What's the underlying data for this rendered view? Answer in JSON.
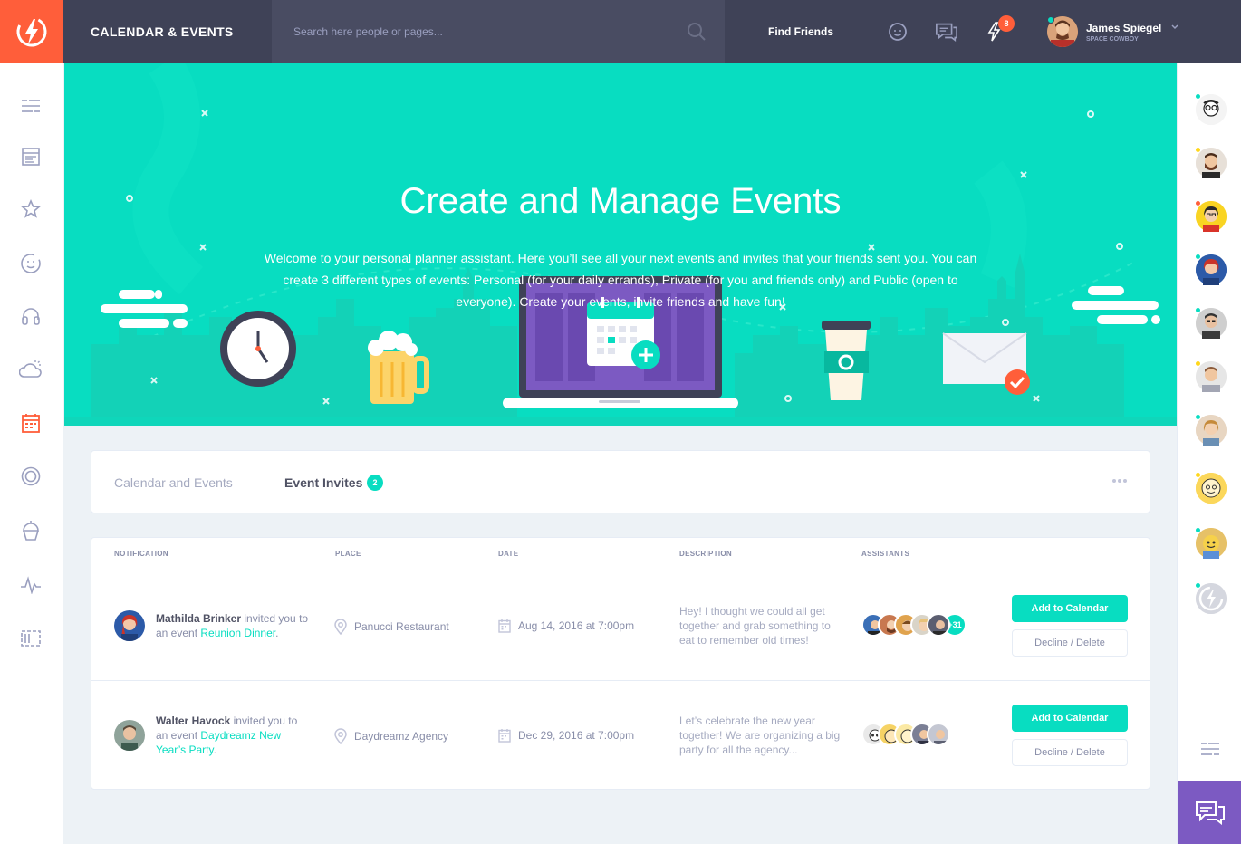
{
  "header": {
    "title": "CALENDAR & EVENTS",
    "search_placeholder": "Search here people or pages...",
    "find_friends": "Find Friends",
    "notification_count": "8",
    "user": {
      "name": "James Spiegel",
      "role": "SPACE COWBOY"
    }
  },
  "hero": {
    "title": "Create and Manage Events",
    "text": "Welcome to your personal planner assistant. Here you’ll see all your next events and invites that your friends sent you. You can create 3 different types of events: Personal (for your daily errands), Private (for you and friends only) and Public (open to everyone). Create your events, invite friends and have fun!"
  },
  "tabs": {
    "items": [
      {
        "label": "Calendar and Events"
      },
      {
        "label": "Event Invites",
        "badge": "2"
      }
    ]
  },
  "table": {
    "columns": [
      "NOTIFICATION",
      "PLACE",
      "DATE",
      "DESCRIPTION",
      "ASSISTANTS"
    ],
    "rows": [
      {
        "name": "Mathilda Brinker",
        "invited_text": " invited you to an event ",
        "event": "Reunion Dinner",
        "end": ".",
        "place": "Panucci Restaurant",
        "date": "Aug 14, 2016 at 7:00pm",
        "description": "Hey! I thought we could all get together and grab something to eat to remember old times!",
        "assistants_more": "+31",
        "add_label": "Add to Calendar",
        "decline_label": "Decline / Delete"
      },
      {
        "name": "Walter Havock",
        "invited_text": " invited you to an event ",
        "event": "Daydreamz New Year’s Party",
        "end": ".",
        "place": "Daydreamz Agency",
        "date": "Dec 29, 2016 at 7:00pm",
        "description": "Let’s celebrate the new year together! We are organizing a big party for all the agency...",
        "add_label": "Add to Calendar",
        "decline_label": "Decline / Delete"
      }
    ]
  },
  "colors": {
    "accent": "#08ddc1",
    "brand": "#ff5e3a",
    "topbar": "#3f4257",
    "purple": "#7c5ac2"
  }
}
